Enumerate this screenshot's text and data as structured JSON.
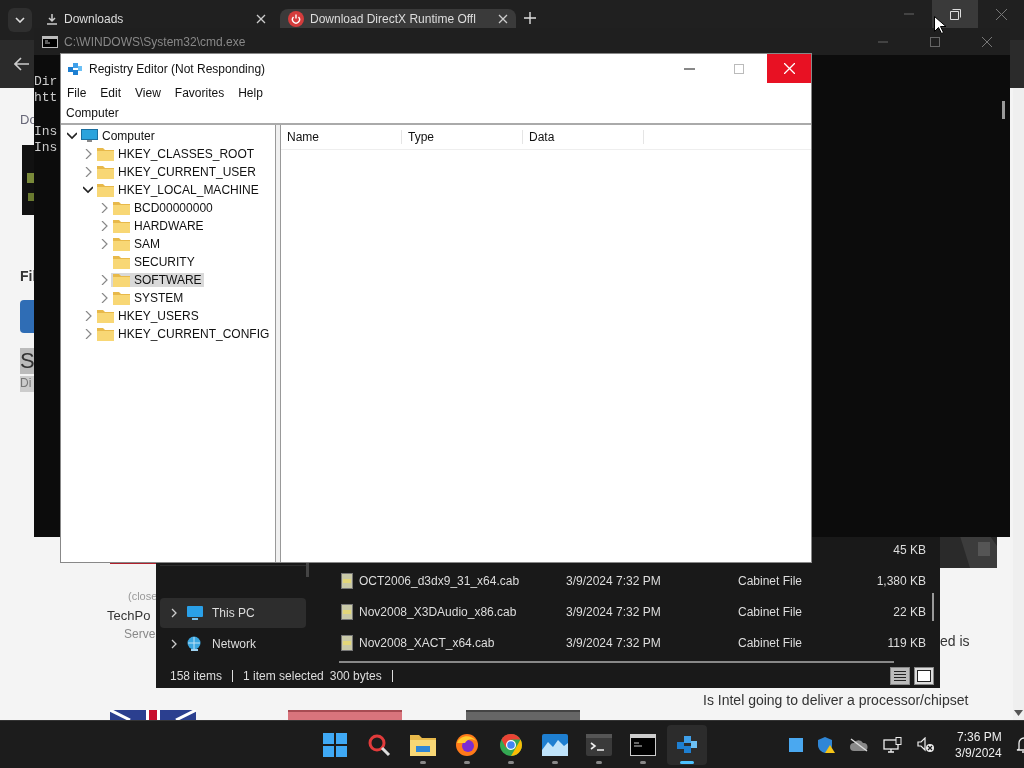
{
  "browser": {
    "tabs": [
      {
        "label": "Downloads",
        "kind": "download",
        "selected": false
      },
      {
        "label": "Download DirectX Runtime Offl",
        "kind": "power",
        "selected": true
      }
    ],
    "page": {
      "link": "Do",
      "heading": "Fil",
      "highlight": [
        "S",
        "Di"
      ],
      "note": "(close",
      "site": "TechPo",
      "subtitle": "Serve",
      "snippet": "ed is",
      "thread_title": "Is Intel going to deliver a processor/chipset"
    }
  },
  "cmd": {
    "title": "C:\\WINDOWS\\System32\\cmd.exe",
    "blocks": [
      [
        "Dir",
        "htt"
      ],
      [
        "Ins",
        "Ins"
      ]
    ]
  },
  "regedit": {
    "title": "Registry Editor (Not Responding)",
    "menu": [
      "File",
      "Edit",
      "View",
      "Favorites",
      "Help"
    ],
    "address": "Computer",
    "tree": [
      {
        "label": "Computer",
        "kind": "computer",
        "expandable": true,
        "expanded": true,
        "selected": false,
        "children": [
          {
            "label": "HKEY_CLASSES_ROOT",
            "kind": "folder",
            "expandable": true,
            "expanded": false,
            "selected": false
          },
          {
            "label": "HKEY_CURRENT_USER",
            "kind": "folder",
            "expandable": true,
            "expanded": false,
            "selected": false
          },
          {
            "label": "HKEY_LOCAL_MACHINE",
            "kind": "folder",
            "expandable": true,
            "expanded": true,
            "selected": false,
            "children": [
              {
                "label": "BCD00000000",
                "kind": "folder",
                "expandable": true,
                "expanded": false,
                "selected": false
              },
              {
                "label": "HARDWARE",
                "kind": "folder",
                "expandable": true,
                "expanded": false,
                "selected": false
              },
              {
                "label": "SAM",
                "kind": "folder",
                "expandable": true,
                "expanded": false,
                "selected": false
              },
              {
                "label": "SECURITY",
                "kind": "folder",
                "expandable": false,
                "expanded": false,
                "selected": false
              },
              {
                "label": "SOFTWARE",
                "kind": "folder",
                "expandable": true,
                "expanded": false,
                "selected": true
              },
              {
                "label": "SYSTEM",
                "kind": "folder",
                "expandable": true,
                "expanded": false,
                "selected": false
              }
            ]
          },
          {
            "label": "HKEY_USERS",
            "kind": "folder",
            "expandable": true,
            "expanded": false,
            "selected": false
          },
          {
            "label": "HKEY_CURRENT_CONFIG",
            "kind": "folder",
            "expandable": true,
            "expanded": false,
            "selected": false
          }
        ]
      }
    ],
    "columns": [
      "Name",
      "Type",
      "Data"
    ]
  },
  "explorer": {
    "nav": [
      {
        "label": "This PC",
        "kind": "pc",
        "selected": true
      },
      {
        "label": "Network",
        "kind": "network",
        "selected": false
      }
    ],
    "files": [
      {
        "size": "45 KB"
      },
      {
        "name": "OCT2006_d3dx9_31_x64.cab",
        "date": "3/9/2024 7:32 PM",
        "type": "Cabinet File",
        "size": "1,380 KB"
      },
      {
        "name": "Nov2008_X3DAudio_x86.cab",
        "date": "3/9/2024 7:32 PM",
        "type": "Cabinet File",
        "size": "22 KB"
      },
      {
        "name": "Nov2008_XACT_x64.cab",
        "date": "3/9/2024 7:32 PM",
        "type": "Cabinet File",
        "size": "119 KB"
      }
    ],
    "status": {
      "count": "158 items",
      "selection": "1 item selected",
      "size": "300 bytes"
    }
  },
  "taskbar": {
    "apps": [
      {
        "kind": "start",
        "running": false,
        "active": false
      },
      {
        "kind": "search",
        "running": false,
        "active": false
      },
      {
        "kind": "folder",
        "running": true,
        "active": false
      },
      {
        "kind": "firefox",
        "running": true,
        "active": false
      },
      {
        "kind": "chrome",
        "running": true,
        "active": false
      },
      {
        "kind": "photos",
        "running": true,
        "active": false
      },
      {
        "kind": "terminal",
        "running": true,
        "active": false
      },
      {
        "kind": "cmd",
        "running": true,
        "active": false
      },
      {
        "kind": "regedit",
        "running": true,
        "active": true
      }
    ],
    "tray": [
      {
        "kind": "tablet"
      },
      {
        "kind": "shield"
      },
      {
        "kind": "cloud"
      },
      {
        "kind": "network"
      },
      {
        "kind": "mute"
      }
    ],
    "time": "7:36 PM",
    "date": "3/9/2024"
  }
}
